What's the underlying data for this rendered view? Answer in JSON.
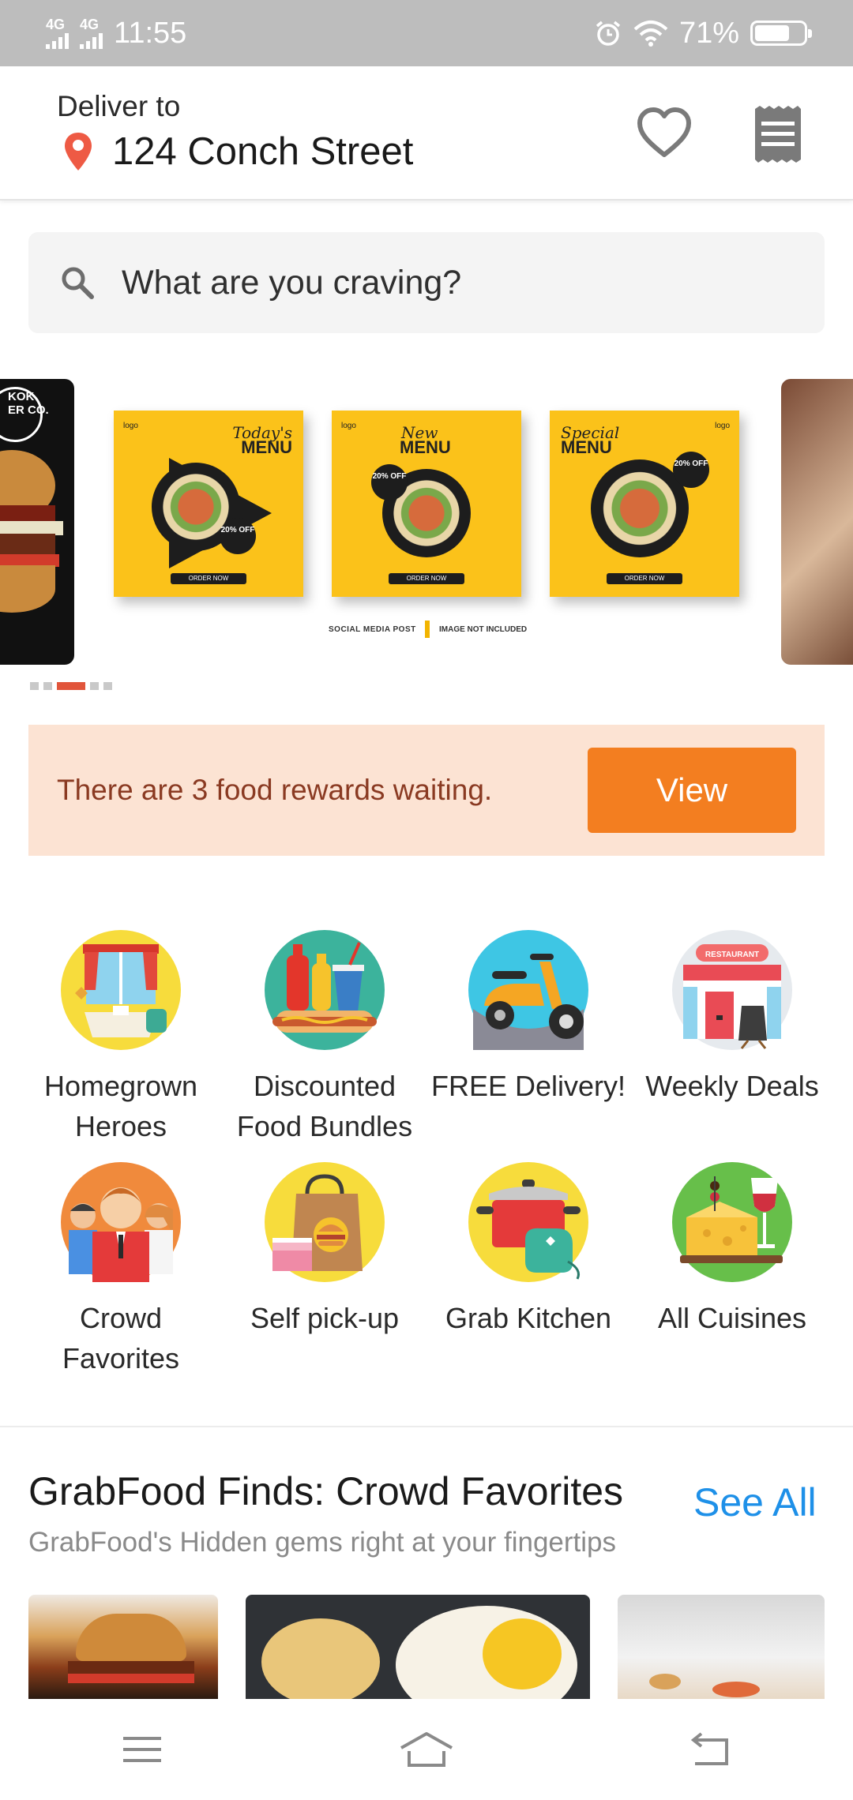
{
  "status_bar": {
    "net1": "4G",
    "net2": "4G",
    "time": "11:55",
    "battery": "71%",
    "battery_level": 0.71
  },
  "header": {
    "deliver_label": "Deliver to",
    "address": "124 Conch Street",
    "icons": [
      "location-pin-icon",
      "heart-icon",
      "receipt-icon"
    ]
  },
  "search": {
    "placeholder": "What are you craving?",
    "icon": "search-icon"
  },
  "carousel": {
    "slide_count": 5,
    "active_index": 3,
    "left_banner_text": "KOK\nER CO.",
    "cards": [
      {
        "line1": "Today's",
        "line2": "MENU",
        "badge": "20% OFF",
        "logo": "logo"
      },
      {
        "line1": "New",
        "line2": "MENU",
        "badge": "20% OFF",
        "logo": "logo"
      },
      {
        "line1": "Special",
        "line2": "MENU",
        "badge": "20% OFF",
        "logo": "logo"
      }
    ],
    "order_label": "ORDER NOW",
    "caption_left": "SOCIAL MEDIA POST",
    "caption_right": "IMAGE NOT INCLUDED"
  },
  "rewards": {
    "message": "There are 3 food rewards waiting.",
    "button": "View"
  },
  "categories": [
    {
      "label": "Homegrown Heroes",
      "icon": "homegrown-heroes-icon"
    },
    {
      "label": "Discounted Food Bundles",
      "icon": "food-bundles-icon"
    },
    {
      "label": "FREE Delivery!",
      "icon": "scooter-icon"
    },
    {
      "label": "Weekly Deals",
      "icon": "restaurant-icon"
    },
    {
      "label": "Crowd Favorites",
      "icon": "crowd-icon"
    },
    {
      "label": "Self pick-up",
      "icon": "pickup-bag-icon"
    },
    {
      "label": "Grab Kitchen",
      "icon": "cooking-pot-icon"
    },
    {
      "label": "All Cuisines",
      "icon": "cheese-wine-icon"
    }
  ],
  "finds": {
    "title": "GrabFood Finds: Crowd Favorites",
    "see_all": "See All",
    "subtitle": "GrabFood's Hidden gems right at your fingertips"
  },
  "nav": {
    "icons": [
      "menu-icon",
      "home-icon",
      "back-icon"
    ]
  },
  "colors": {
    "accent_orange": "#f37e20",
    "link_blue": "#1e90e8",
    "rewards_bg": "#fce3d3",
    "rewards_text": "#8a3a22",
    "status_bar": "#bdbdbd"
  }
}
